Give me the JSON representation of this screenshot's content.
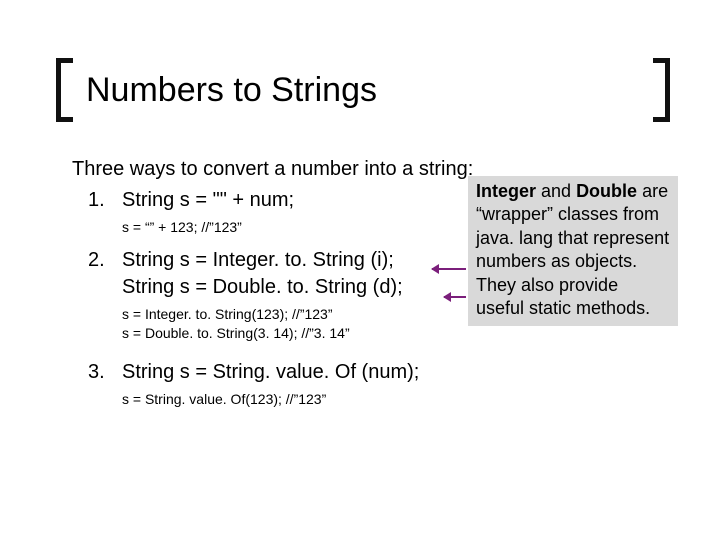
{
  "title": "Numbers to Strings",
  "intro": "Three ways to convert a number into a string:",
  "items": {
    "one": {
      "num": "1.",
      "line": "String s = \"\" + num;",
      "note": "s = “” + 123; //”123”"
    },
    "two": {
      "num": "2.",
      "line1": "String s = Integer. to. String (i);",
      "line2": "String s = Double. to. String (d);",
      "note1": "s = Integer. to. String(123); //”123”",
      "note2": "s = Double. to. String(3. 14); //”3. 14”"
    },
    "three": {
      "num": "3.",
      "line": "String s = String. value. Of (num);",
      "note": "s = String. value. Of(123); //”123”"
    }
  },
  "sidebox": {
    "bold1": "Integer",
    "mid1": " and ",
    "bold2": "Double",
    "rest": " are “wrapper” classes from java. lang that represent numbers as objects.  They also provide useful static methods."
  }
}
